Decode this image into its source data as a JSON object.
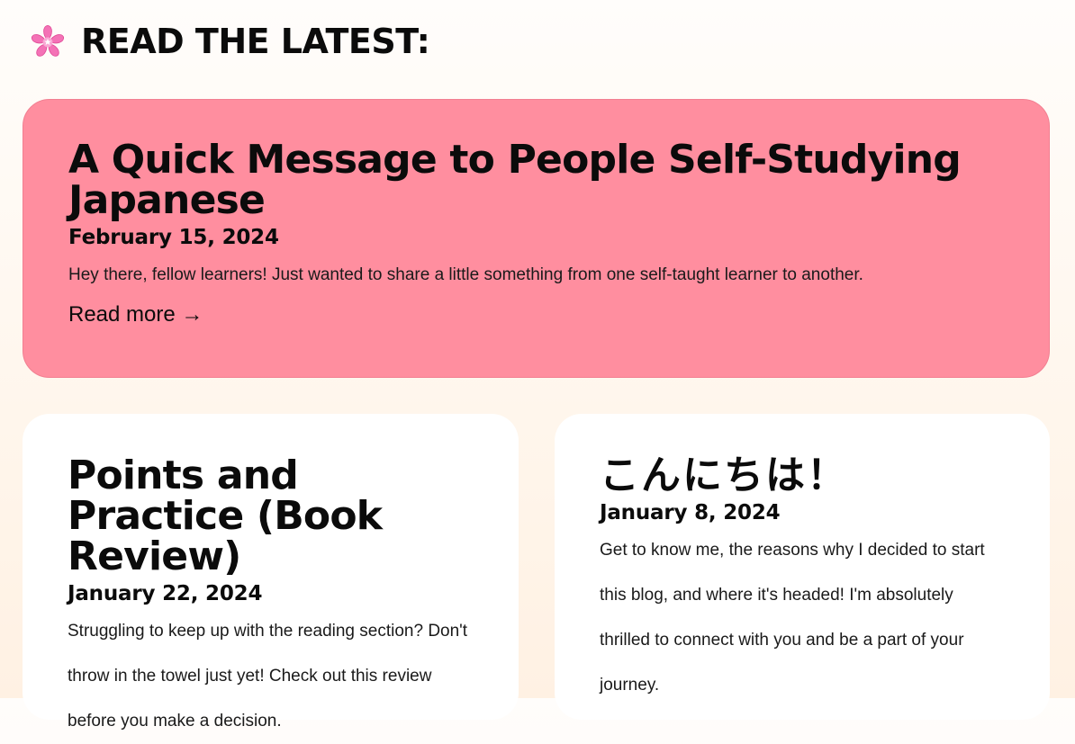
{
  "section": {
    "icon": "sakura-flower-icon",
    "title": "READ THE LATEST:"
  },
  "featured_post": {
    "title": "A Quick Message to People Self-Studying Japanese",
    "date": "February 15, 2024",
    "excerpt": "Hey there, fellow learners! Just wanted to share a little something from one self-taught learner to another.",
    "read_more": "Read more →",
    "background_color": "#ff8e9f"
  },
  "posts": [
    {
      "title": "Points and Practice (Book Review)",
      "date": "January 22, 2024",
      "excerpt": "Struggling to keep up with the reading section? Don't throw in the towel just yet! Check out this review before you make a decision."
    },
    {
      "title": "こんにちは！",
      "date": "January 8, 2024",
      "excerpt": "Get to know me, the reasons why I decided to start this blog, and where it's headed! I'm absolutely thrilled to connect with you and be a part of your journey."
    }
  ],
  "colors": {
    "accent_pink": "#ff8e9f",
    "card_white": "#ffffff",
    "flower_pink": "#f472b6"
  }
}
